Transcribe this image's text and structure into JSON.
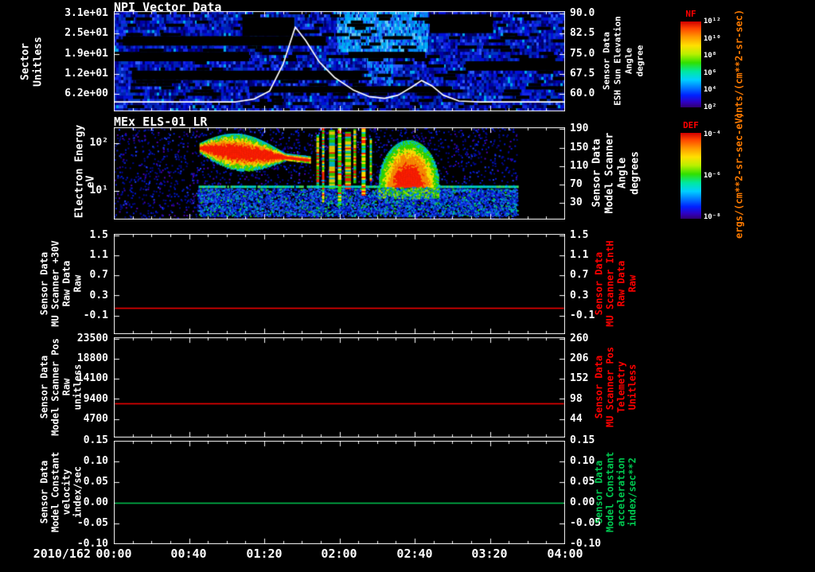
{
  "x_axis": {
    "date": "2010/162",
    "ticks": [
      "00:00",
      "00:40",
      "01:20",
      "02:00",
      "02:40",
      "03:20",
      "04:00"
    ]
  },
  "chart_data": [
    {
      "type": "heatmap",
      "title": "NPI Vector Data",
      "left_axis": {
        "lines": [
          "Sector",
          "Unitless"
        ],
        "ticks": [
          "3.1e+01",
          "2.5e+01",
          "1.9e+01",
          "1.2e+01",
          "6.2e+00"
        ]
      },
      "right_axis": {
        "lines": [
          "Sensor Data",
          "ESH Sun Elevation",
          "Angle",
          "degree"
        ],
        "ticks": [
          "90.0",
          "82.5",
          "75.0",
          "67.5",
          "60.0"
        ]
      },
      "colorbar": {
        "name": "NF",
        "units": "cnts/(cm**2-sr-sec)",
        "ticks": [
          "10¹²",
          "10¹⁰",
          "10⁸",
          "10⁶",
          "10⁴",
          "10²"
        ]
      },
      "overlay_line": {
        "name": "ESH Sun Elevation Angle",
        "color": "#ffffff",
        "points": [
          [
            0,
            57
          ],
          [
            0.27,
            57
          ],
          [
            0.31,
            58
          ],
          [
            0.345,
            61
          ],
          [
            0.375,
            71
          ],
          [
            0.402,
            85
          ],
          [
            0.425,
            80
          ],
          [
            0.455,
            72
          ],
          [
            0.49,
            66
          ],
          [
            0.53,
            61.5
          ],
          [
            0.565,
            59
          ],
          [
            0.6,
            58.3
          ],
          [
            0.63,
            59.5
          ],
          [
            0.66,
            62.5
          ],
          [
            0.682,
            65
          ],
          [
            0.705,
            63
          ],
          [
            0.73,
            59.5
          ],
          [
            0.765,
            57.3
          ],
          [
            0.81,
            57
          ],
          [
            1,
            57
          ]
        ]
      },
      "texture": {
        "rows": 32,
        "black_segments": [
          {
            "r0": 2,
            "r1": 7,
            "x0": 0.285,
            "x1": 0.4
          },
          {
            "r0": 1,
            "r1": 6,
            "x0": 0.7,
            "x1": 0.84
          },
          {
            "r0": 8,
            "r1": 10,
            "x0": 0.02,
            "x1": 0.47
          },
          {
            "r0": 13,
            "r1": 15,
            "x0": 0,
            "x1": 0.3
          },
          {
            "r0": 13,
            "r1": 14,
            "x0": 0.52,
            "x1": 0.69
          },
          {
            "r0": 16,
            "r1": 18,
            "x0": 0.78,
            "x1": 1
          },
          {
            "r0": 19,
            "r1": 21,
            "x0": 0.04,
            "x1": 0.55
          },
          {
            "r0": 24,
            "r1": 25,
            "x0": 0.3,
            "x1": 0.75
          }
        ],
        "bright_region": {
          "r0": 0,
          "r1": 12,
          "x0": 0.495,
          "x1": 0.695
        },
        "bright_streaks": {
          "r0": 12,
          "r1": 22,
          "x0": 0.555,
          "x1": 0.615
        }
      }
    },
    {
      "type": "heatmap",
      "title": "MEx ELS-01 LR",
      "left_axis": {
        "lines": [
          "Electron Energy",
          "eV"
        ],
        "ticks": [
          "10²",
          "10¹"
        ]
      },
      "right_axis": {
        "lines": [
          "Sensor Data",
          "Model Scanner",
          "Angle",
          "degrees"
        ],
        "ticks": [
          "190",
          "150",
          "110",
          "70",
          "30"
        ]
      },
      "colorbar": {
        "name": "DEF",
        "units": "ergs/(cm**2-sr-sec-eV)",
        "ticks": [
          "10⁻⁴",
          "10⁻⁶",
          "10⁻⁸"
        ]
      },
      "texture": {
        "data_end": 0.894,
        "line_y": 0.645,
        "blob1": {
          "x0": 0.19,
          "x1": 0.435
        },
        "stripes": [
          [
            0.449,
            0.006,
            0.08,
            0.66
          ],
          [
            0.4615,
            0.005,
            0,
            0.8
          ],
          [
            0.477,
            0.013,
            0.03,
            0.66
          ],
          [
            0.4965,
            0.008,
            0,
            0.84
          ],
          [
            0.5125,
            0.013,
            0.05,
            0.66
          ],
          [
            0.531,
            0.006,
            0.02,
            0.6
          ],
          [
            0.549,
            0.009,
            0,
            0.74
          ],
          [
            0.567,
            0.005,
            0.12,
            0.58
          ]
        ],
        "blob2": {
          "x0": 0.585,
          "x1": 0.72,
          "top": 0.14
        }
      }
    },
    {
      "type": "line",
      "left_axis": {
        "lines": [
          "Sensor Data",
          "MU Scanner +30V",
          "Raw Data",
          "Raw"
        ],
        "ticks": [
          "1.5",
          "1.1",
          "0.7",
          "0.3",
          "-0.1"
        ]
      },
      "right_axis": {
        "lines": [
          "Sensor Data",
          "MU Scanner IntH",
          "Raw Data",
          "Raw"
        ],
        "ticks": [
          "1.5",
          "1.1",
          "0.7",
          "0.3",
          "-0.1"
        ],
        "color": "#ff0000"
      },
      "series": [
        {
          "name": "MU Scanner +30V Raw Data",
          "color": "#ff0000",
          "value": 0.0,
          "y_frac": 0.738
        }
      ]
    },
    {
      "type": "line",
      "left_axis": {
        "lines": [
          "Sensor Data",
          "Model Scanner Pos",
          "Raw",
          "unitless"
        ],
        "ticks": [
          "23500",
          "18800",
          "14100",
          "9400",
          "4700"
        ]
      },
      "right_axis": {
        "lines": [
          "Sensor Data",
          "MU Scanner Pos",
          "Telemetry",
          "Unitless"
        ],
        "ticks": [
          "260",
          "206",
          "152",
          "98",
          "44"
        ],
        "color": "#ff0000"
      },
      "series": [
        {
          "name": "Model Scanner Pos Raw",
          "color": "#ff0000",
          "value": 8400,
          "y_frac": 0.659
        }
      ]
    },
    {
      "type": "line",
      "left_axis": {
        "lines": [
          "Sensor Data",
          "Model Constant",
          "velocity",
          "index/sec"
        ],
        "ticks": [
          "0.15",
          "0.10",
          "0.05",
          "0.00",
          "-0.05",
          "-0.10"
        ]
      },
      "right_axis": {
        "lines": [
          "Sensor Data",
          "Model Constant",
          "acceleration",
          "index/sec**2"
        ],
        "ticks": [
          "0.15",
          "0.10",
          "0.05",
          "0.00",
          "-0.05",
          "-0.10"
        ],
        "color": "#00c850"
      },
      "series": [
        {
          "name": "Model Constant velocity",
          "color": "#00c850",
          "value": 0.0,
          "y_frac": 0.6
        }
      ]
    }
  ]
}
